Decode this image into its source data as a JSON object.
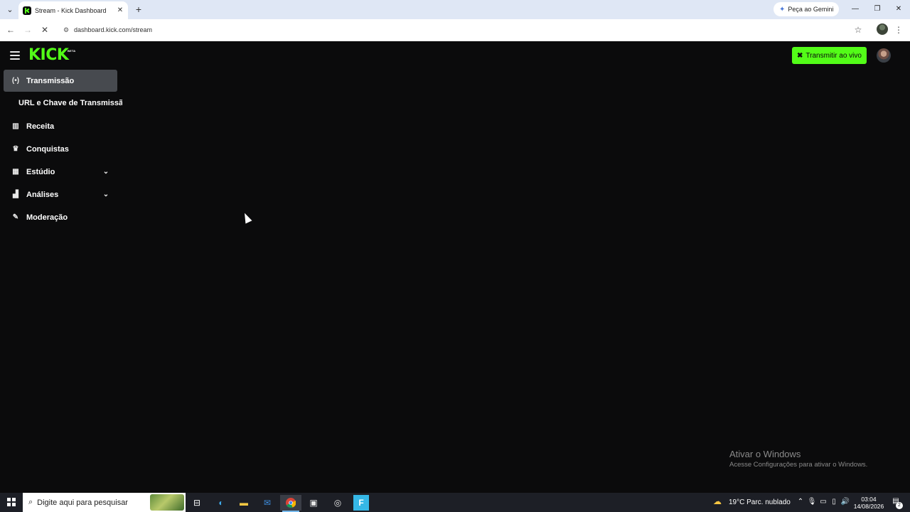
{
  "browser": {
    "tab_search_icon": "chevron-down",
    "tab": {
      "title": "Stream - Kick Dashboard",
      "favicon": "kick-favicon",
      "close": "✕"
    },
    "new_tab": "+",
    "gemini": {
      "label": "Peça ao Gemini",
      "icon": "sparkle-icon"
    },
    "window_controls": {
      "minimize": "—",
      "restore": "❐",
      "close": "✕"
    },
    "url": "dashboard.kick.com/stream",
    "nav": {
      "back": "←",
      "forward": "→",
      "reload": "✕"
    }
  },
  "header": {
    "logo": "KICK",
    "logo_badge": "BETA",
    "live_button": "Transmitir ao vivo",
    "brand_color": "#53fc18"
  },
  "sidebar": {
    "items": [
      {
        "label": "Transmissão",
        "icon": "broadcast-icon",
        "active": true
      },
      {
        "label": "URL e Chave de Transmissão",
        "sub": true
      },
      {
        "label": "Receita",
        "icon": "bar-chart-icon"
      },
      {
        "label": "Conquistas",
        "icon": "trophy-icon"
      },
      {
        "label": "Estúdio",
        "icon": "studio-icon",
        "expandable": true
      },
      {
        "label": "Análises",
        "icon": "analytics-icon",
        "expandable": true
      },
      {
        "label": "Moderação",
        "icon": "wrench-icon"
      }
    ]
  },
  "watermark": {
    "title": "Ativar o Windows",
    "subtitle": "Acesse Configurações para ativar o Windows."
  },
  "taskbar": {
    "search_placeholder": "Digite aqui para pesquisar",
    "weather": "19°C  Parc. nublado",
    "time": "03:04",
    "date": "14/08/2026",
    "notification_count": "2"
  }
}
